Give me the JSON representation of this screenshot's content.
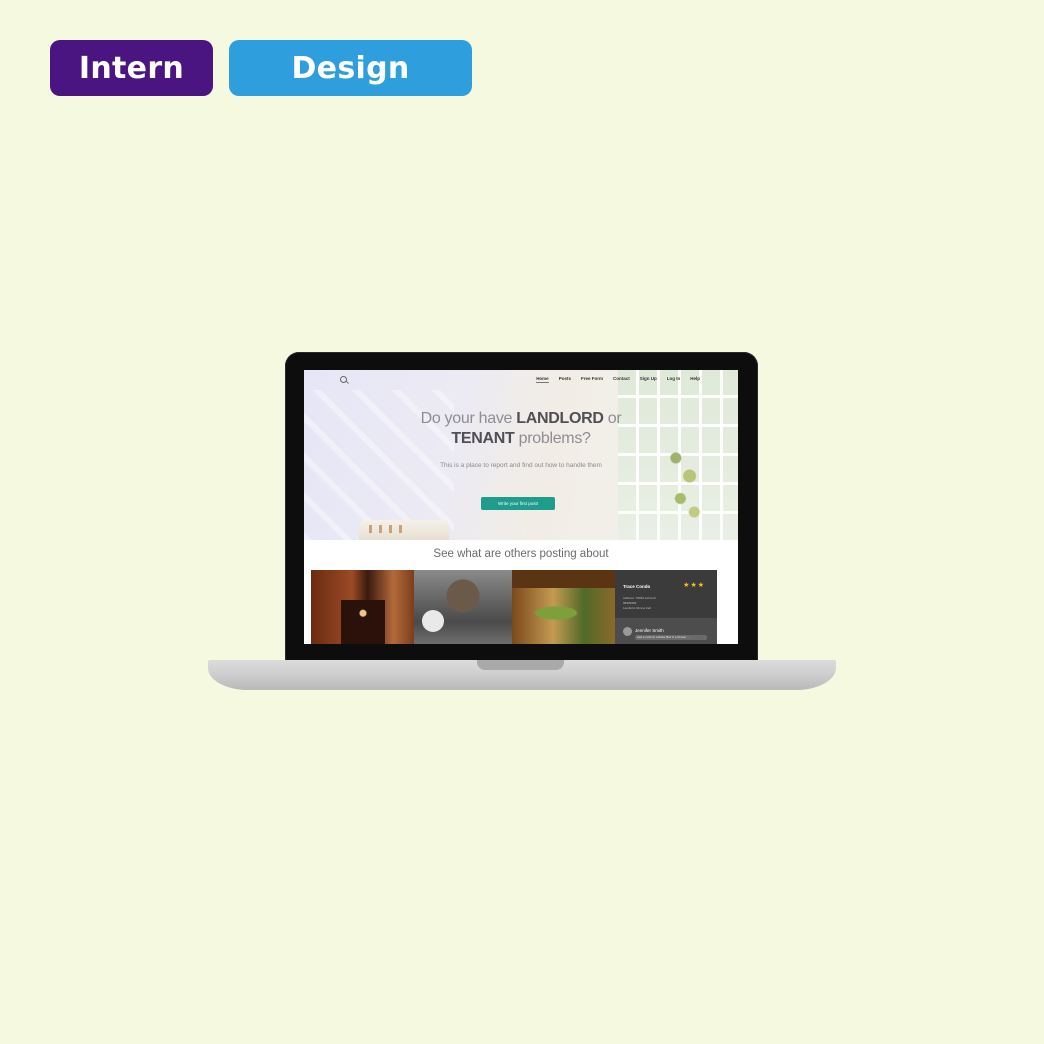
{
  "tags": {
    "intern": {
      "label": "Intern",
      "color": "#4a1580"
    },
    "design": {
      "label": "Design",
      "color": "#2e9fdc"
    }
  },
  "site": {
    "nav": [
      "Home",
      "Posts",
      "Free Form",
      "Contact",
      "Sign Up",
      "Log In",
      "Help"
    ],
    "headline": {
      "line1_pre": "Do your have ",
      "line1_bold": "LANDLORD",
      "line1_post": " or",
      "line2_bold": "TENANT",
      "line2_post": " problems?"
    },
    "subtitle": "This is a place to report and find out how to handle them",
    "cta_label": "Write your first post!",
    "cta_color": "#1e9c8c",
    "section_title": "See what are others posting about",
    "review": {
      "name": "Trace Condo",
      "stars": "★★★",
      "line1": "Address: 78930 Ashcroft",
      "line2": "98999999",
      "line3": "Landlord: Rimna Kell",
      "author": "Jennifer Smith",
      "comment": "Had a mold on a Raise Bed in a shower ..."
    }
  }
}
